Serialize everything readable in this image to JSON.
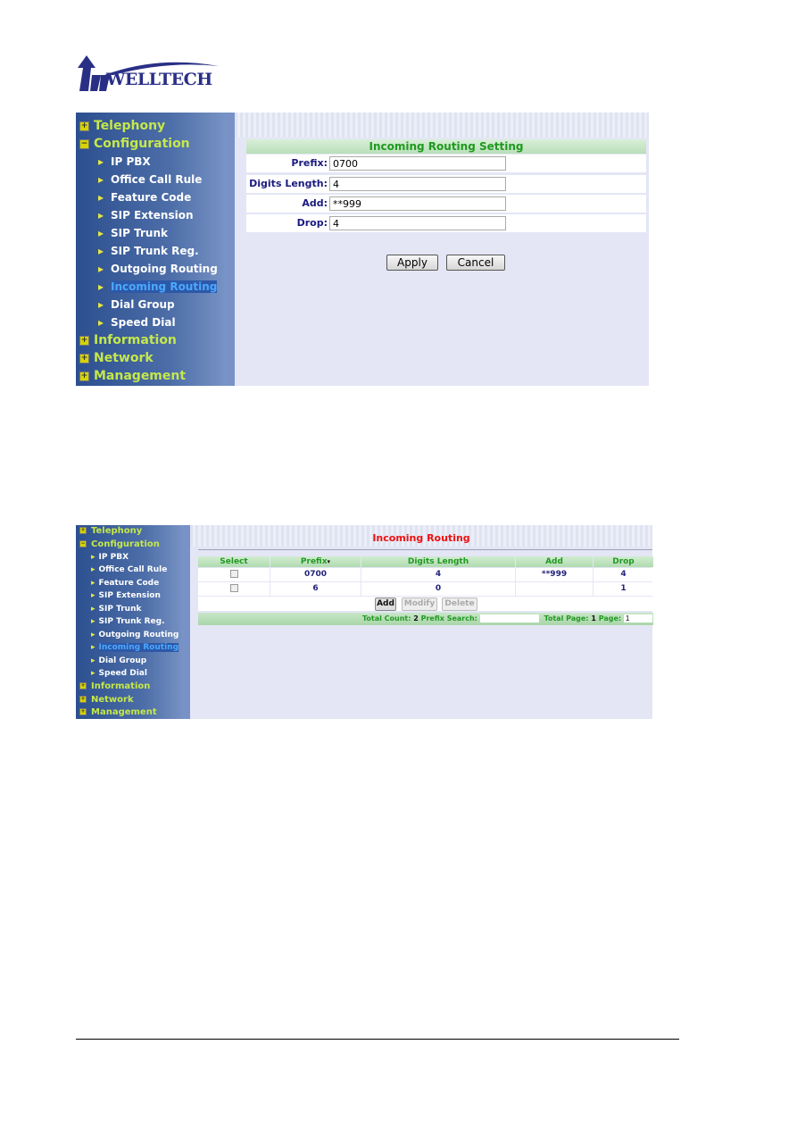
{
  "logo": {
    "text": "WELLTECH"
  },
  "screenshot1": {
    "sidebar": {
      "sections": [
        "Telephony",
        "Configuration",
        "Information",
        "Network",
        "Management"
      ],
      "config_items": [
        "IP PBX",
        "Office Call Rule",
        "Feature Code",
        "SIP Extension",
        "SIP Trunk",
        "SIP Trunk Reg.",
        "Outgoing Routing",
        "Incoming Routing",
        "Dial Group",
        "Speed Dial"
      ],
      "active": "Incoming Routing"
    },
    "form": {
      "title": "Incoming Routing Setting",
      "fields": [
        {
          "label": "Prefix:",
          "value": "0700"
        },
        {
          "label": "Digits Length:",
          "value": "4"
        },
        {
          "label": "Add:",
          "value": "**999"
        },
        {
          "label": "Drop:",
          "value": "4"
        }
      ],
      "apply": "Apply",
      "cancel": "Cancel"
    }
  },
  "screenshot2": {
    "title": "Incoming Routing",
    "columns": [
      "Select",
      "Prefix",
      "Digits Length",
      "Add",
      "Drop"
    ],
    "sort_indicator": "▾",
    "rows": [
      {
        "prefix": "0700",
        "digits_length": "4",
        "add": "**999",
        "drop": "4"
      },
      {
        "prefix": "6",
        "digits_length": "0",
        "add": "",
        "drop": "1"
      }
    ],
    "buttons": {
      "add": "Add",
      "modify": "Modify",
      "delete": "Delete"
    },
    "footer": {
      "total_count_label": "Total Count:",
      "total_count": "2",
      "prefix_search_label": "Prefix Search:",
      "prefix_search_value": "",
      "total_page_label": "Total Page:",
      "total_page": "1",
      "page_label": "Page:",
      "page": "1"
    }
  },
  "colors": {
    "sidebar": "#3d5f9e",
    "menu_section": "#c5e84a",
    "active_item": "#4aa8ff",
    "header_green": "#1f9a1f",
    "title_red": "#ee1111"
  }
}
